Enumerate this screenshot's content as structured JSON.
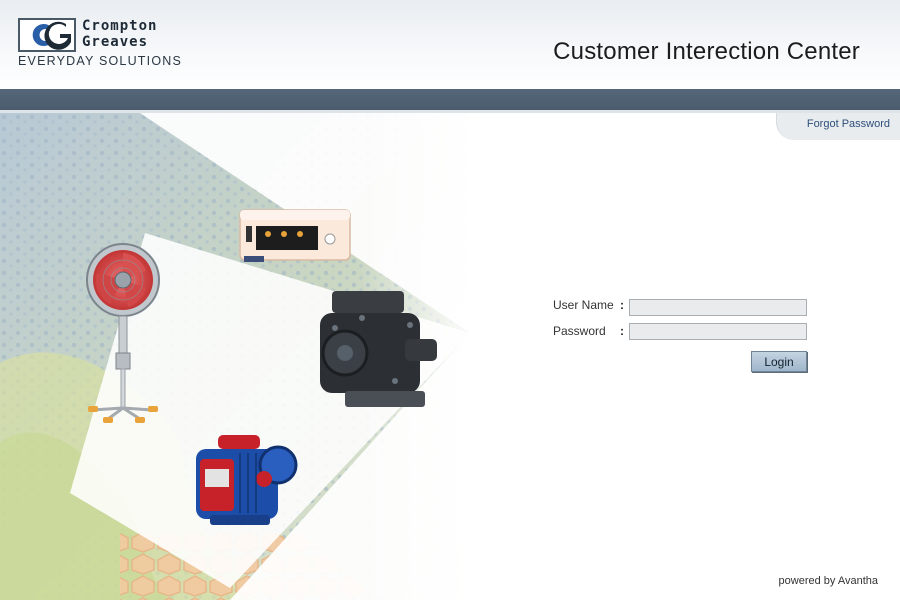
{
  "header": {
    "logo_line1": "Crompton",
    "logo_line2": "Greaves",
    "logo_tagline": "EVERYDAY SOLUTIONS",
    "title": "Customer Interection Center"
  },
  "nav": {
    "forgot_password": "Forgot Password"
  },
  "login": {
    "username_label": "User Name",
    "password_label": "Password",
    "colon": ":",
    "username_value": "",
    "password_value": "",
    "login_button": "Login"
  },
  "footer": {
    "powered_by": "powered by Avantha"
  },
  "colors": {
    "nav_bar": "#4a5b6d",
    "link": "#2e4f7a",
    "button": "#9fb6cb"
  },
  "icons": [
    "cg-logo-icon",
    "stand-fan-image",
    "inverter-image",
    "pump-image",
    "monoblock-pump-image"
  ]
}
